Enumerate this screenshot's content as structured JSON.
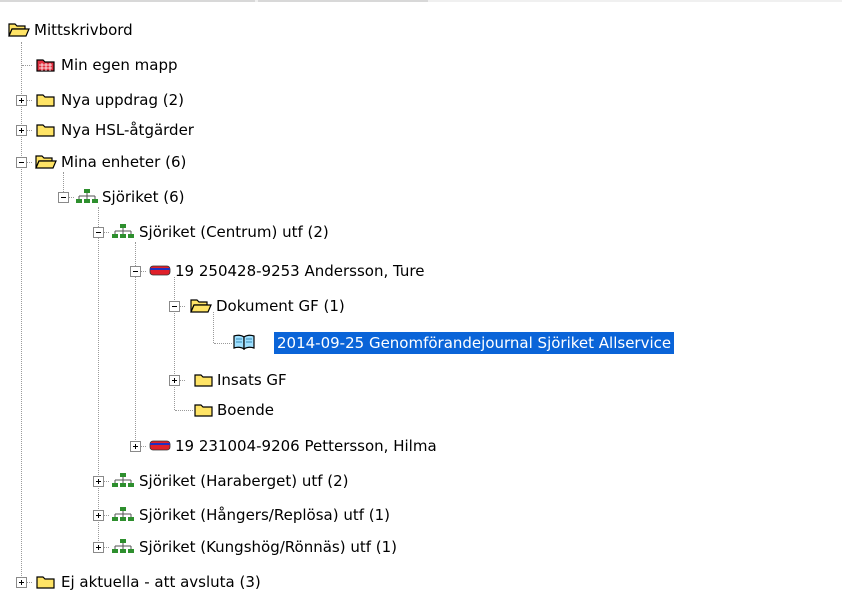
{
  "tree": {
    "root": "Mittskrivbord",
    "items": [
      "Min egen mapp",
      "Nya uppdrag (2)",
      "Nya HSL-åtgärder",
      "Mina enheter (6)",
      "Sjöriket (6)",
      "Sjöriket (Centrum) utf (2)",
      "19 250428-9253 Andersson, Ture",
      "Dokument GF (1)",
      "2014-09-25 Genomförandejournal Sjöriket Allservice",
      "Insats GF",
      "Boende",
      "19 231004-9206 Pettersson, Hilma",
      "Sjöriket (Haraberget) utf (2)",
      "Sjöriket (Hångers/Replösa) utf (1)",
      "Sjöriket (Kungshög/Rönnäs) utf (1)",
      "Ej aktuella - att avsluta (3)"
    ]
  },
  "colors": {
    "selection": "#0a64d8",
    "folder": "#ffe466",
    "client_icon": "#e0202a",
    "unit_icon": "#2e8f2e"
  }
}
